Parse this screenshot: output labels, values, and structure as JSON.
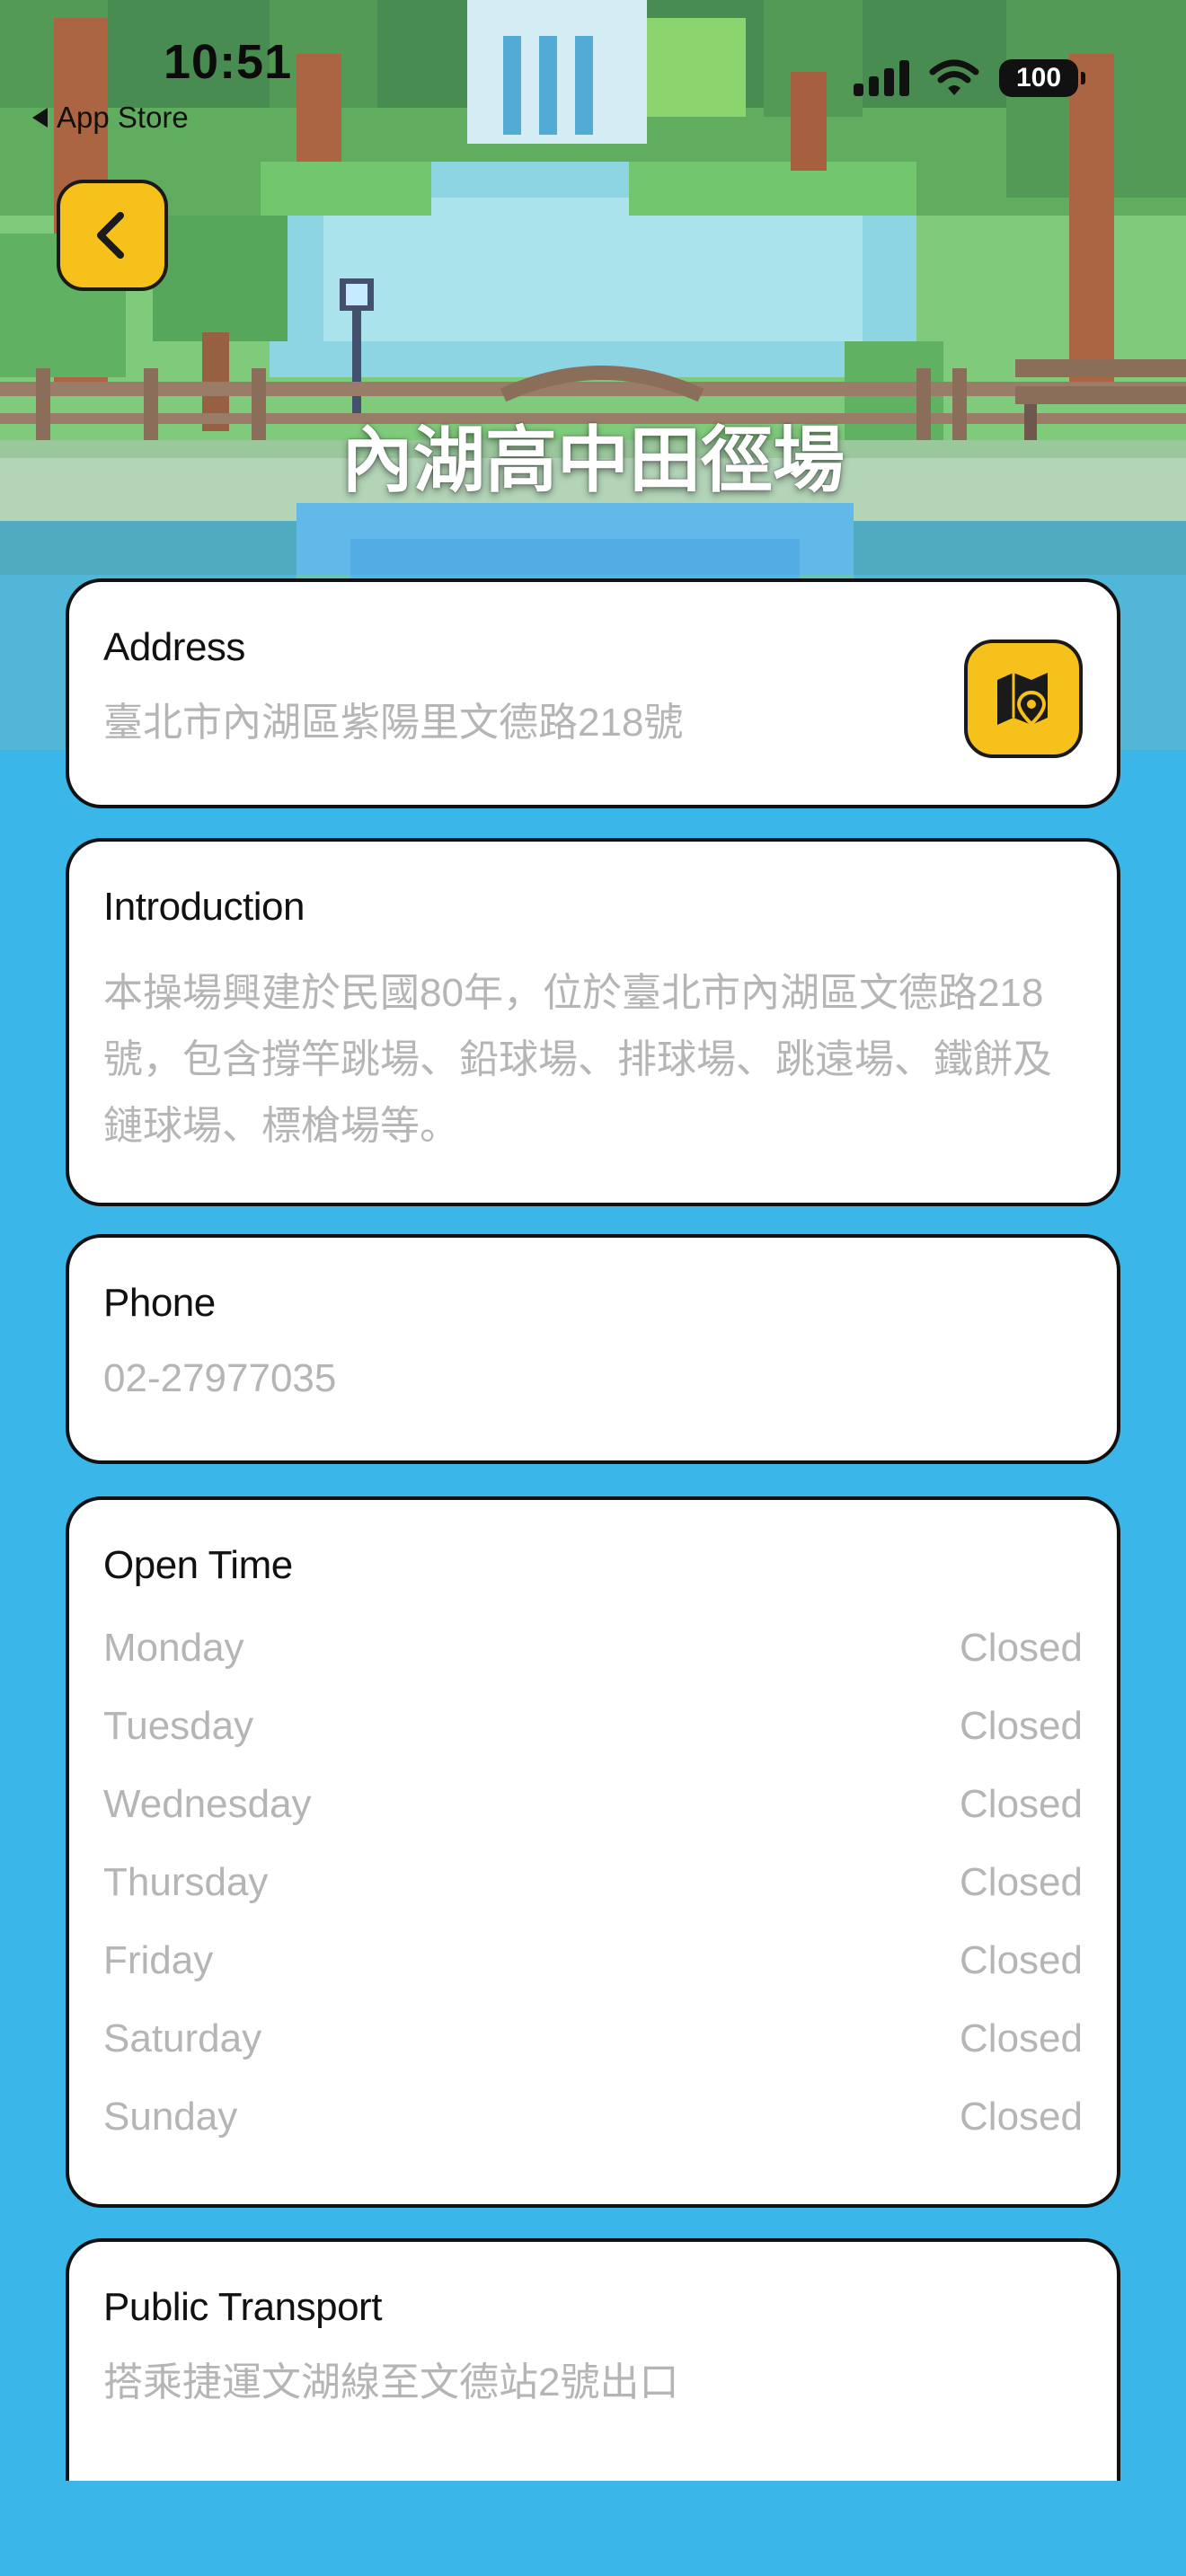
{
  "status_bar": {
    "time": "10:51",
    "back_app": "App Store",
    "battery": "100"
  },
  "header": {
    "title": "內湖高中田徑場"
  },
  "address": {
    "label": "Address",
    "value": "臺北市內湖區紫陽里文德路218號"
  },
  "introduction": {
    "label": "Introduction",
    "lines": [
      "本操場興建於民國80年，位於臺北市內湖區文德路218",
      "號，包含撐竿跳場、鉛球場、排球場、跳遠場、鐵餅及",
      "鏈球場、標槍場等。"
    ]
  },
  "phone": {
    "label": "Phone",
    "value": "02-27977035"
  },
  "open_time": {
    "label": "Open Time",
    "days": [
      {
        "day": "Monday",
        "status": "Closed"
      },
      {
        "day": "Tuesday",
        "status": "Closed"
      },
      {
        "day": "Wednesday",
        "status": "Closed"
      },
      {
        "day": "Thursday",
        "status": "Closed"
      },
      {
        "day": "Friday",
        "status": "Closed"
      },
      {
        "day": "Saturday",
        "status": "Closed"
      },
      {
        "day": "Sunday",
        "status": "Closed"
      }
    ]
  },
  "public_transport": {
    "label": "Public Transport",
    "value": "搭乘捷運文湖線至文德站2號出口"
  },
  "colors": {
    "background": "#3bb6e8",
    "accent_button": "#f5c11a",
    "card_border": "#111111",
    "muted_text": "#b5b5b5"
  },
  "icons": [
    "back-chevron-icon",
    "map-location-icon",
    "cellular-signal-icon",
    "wifi-icon",
    "battery-icon"
  ]
}
